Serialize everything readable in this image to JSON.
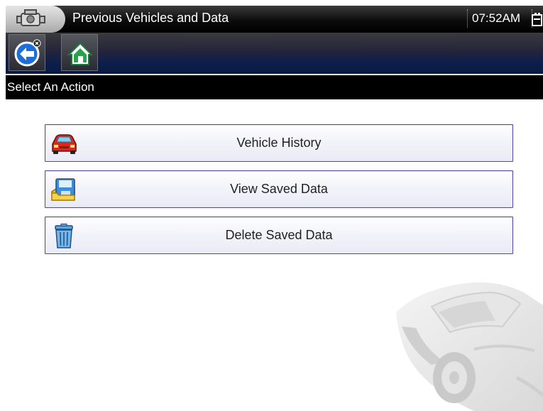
{
  "titlebar": {
    "title": "Previous Vehicles and Data",
    "clock": "07:52AM",
    "icons": {
      "app": "engine-icon",
      "battery": "battery-icon"
    }
  },
  "toolbar": {
    "back_icon": "back-arrow-icon",
    "home_icon": "home-icon"
  },
  "header": {
    "text": "Select An Action"
  },
  "actions": [
    {
      "label": "Vehicle History",
      "icon": "car-icon"
    },
    {
      "label": "View Saved Data",
      "icon": "floppy-disk-icon"
    },
    {
      "label": "Delete Saved Data",
      "icon": "trash-can-icon"
    }
  ],
  "colors": {
    "button_border": "#52499e",
    "titlebar_bg": "#000000",
    "toolbar_bg": "#0d1e4d",
    "accent_blue": "#1d6ed8"
  }
}
